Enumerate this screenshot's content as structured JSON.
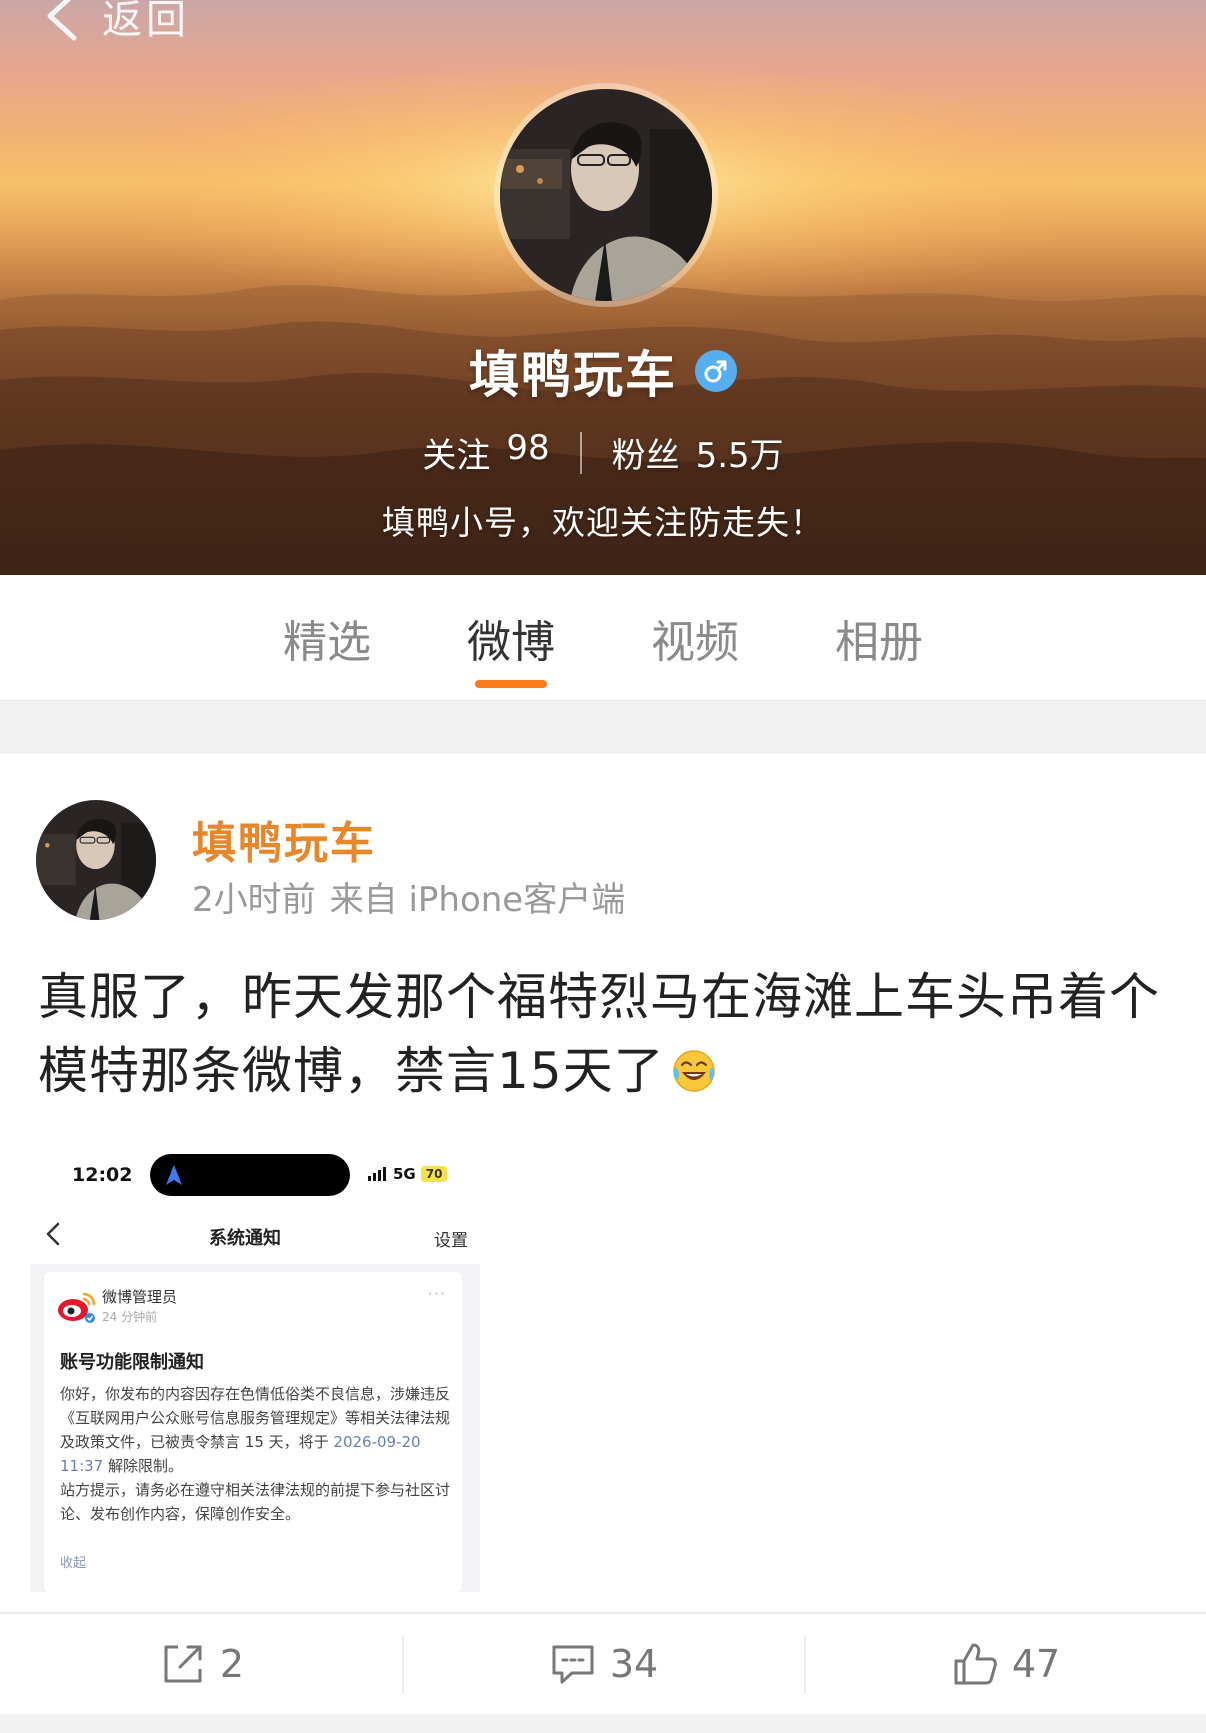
{
  "header": {
    "back_label": "返回",
    "nickname": "填鸭玩车",
    "gender_badge": "♂",
    "follow_label": "关注",
    "follow_count": "98",
    "fans_label": "粉丝",
    "fans_count": "5.5万",
    "bio": "填鸭小号，欢迎关注防走失！"
  },
  "tabs": [
    {
      "label": "精选",
      "active": false
    },
    {
      "label": "微博",
      "active": true
    },
    {
      "label": "视频",
      "active": false
    },
    {
      "label": "相册",
      "active": false
    }
  ],
  "post": {
    "author": "填鸭玩车",
    "time": "2小时前",
    "source": "来自 iPhone客户端",
    "text": "真服了，昨天发那个福特烈马在海滩上车头吊着个模特那条微博，禁言15天了",
    "emoji": "laughing-tears-emoji",
    "screenshot": {
      "time": "12:02",
      "network": "5G",
      "battery": "70",
      "title": "系统通知",
      "settings": "设置",
      "sender": "微博管理员",
      "sent_time": "24 分钟前",
      "more": "···",
      "notice_title": "账号功能限制通知",
      "body_1": "你好，你发布的内容因存在色情低俗类不良信息，涉嫌违反《互联网用户公众账号信息服务管理规定》等相关法律法规及政策文件，已被责令禁言 15 天，将于 ",
      "release_time": "2026-09-20 11:37",
      "body_2": " 解除限制。",
      "body_3": "站方提示，请务必在遵守相关法律法规的前提下参与社区讨论、发布创作内容，保障创作安全。",
      "collapse": "收起"
    },
    "reposts": "2",
    "comments": "34",
    "likes": "47"
  },
  "colors": {
    "accent": "#ff7b1a",
    "author_name": "#e8862a",
    "verified_blue": "#55aef0"
  }
}
